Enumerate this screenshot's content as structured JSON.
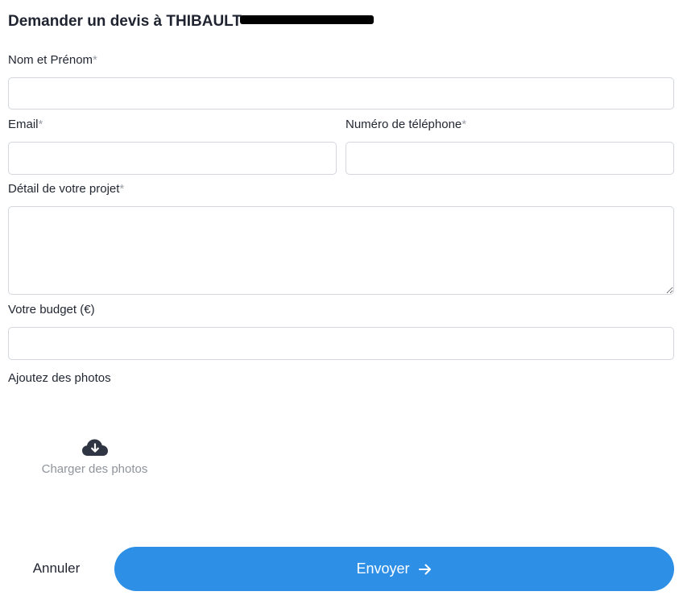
{
  "form": {
    "title": "Demander un devis à THIBAULT",
    "required_mark": "*",
    "name_label": "Nom et Prénom",
    "email_label": "Email",
    "phone_label": "Numéro de téléphone",
    "details_label": "Détail de votre projet",
    "budget_label": "Votre budget (€)",
    "photos_label": "Ajoutez des photos",
    "upload_text": "Charger des photos",
    "upload_icon": "cloud-download-icon",
    "name_value": "",
    "email_value": "",
    "phone_value": "",
    "details_value": "",
    "budget_value": ""
  },
  "actions": {
    "cancel_label": "Annuler",
    "submit_label": "Envoyer",
    "submit_icon": "arrow-right-icon"
  },
  "colors": {
    "primary": "#2d8fe6",
    "text": "#1f2430",
    "muted": "#8f949c",
    "border": "#d3d6db"
  }
}
